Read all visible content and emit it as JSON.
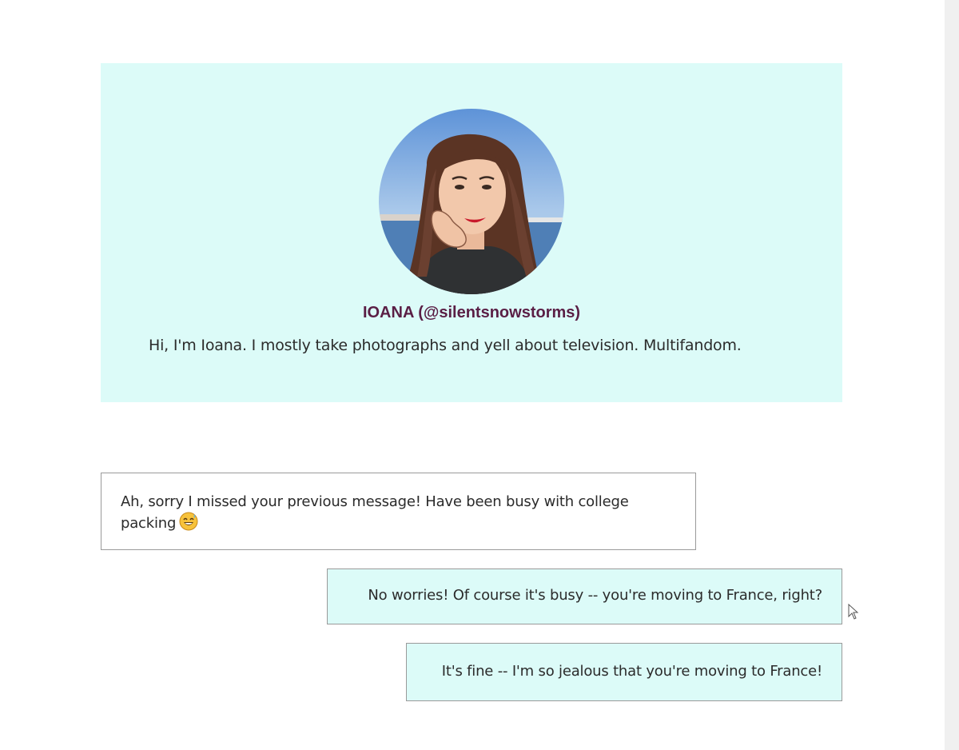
{
  "profile": {
    "name": "IOANA (@silentsnowstorms)",
    "bio": "Hi, I'm Ioana. I mostly take photographs and yell about television. Multifandom.",
    "avatar_icon": "avatar-illustration",
    "card_color": "#dcfbf8",
    "name_color": "#5a1e45"
  },
  "messages": [
    {
      "direction": "received",
      "text": "Ah, sorry I missed your previous message! Have been busy with college packing",
      "emoji": "grinning-sweat-emoji"
    },
    {
      "direction": "sent",
      "text": "No worries! Of course it's busy -- you're moving to France, right?"
    },
    {
      "direction": "sent",
      "text": "It's fine -- I'm so jealous that you're moving to France!"
    }
  ],
  "colors": {
    "sent_bubble": "#dcfbf8",
    "received_bubble": "#ffffff",
    "bubble_border": "#9a9a9a"
  }
}
